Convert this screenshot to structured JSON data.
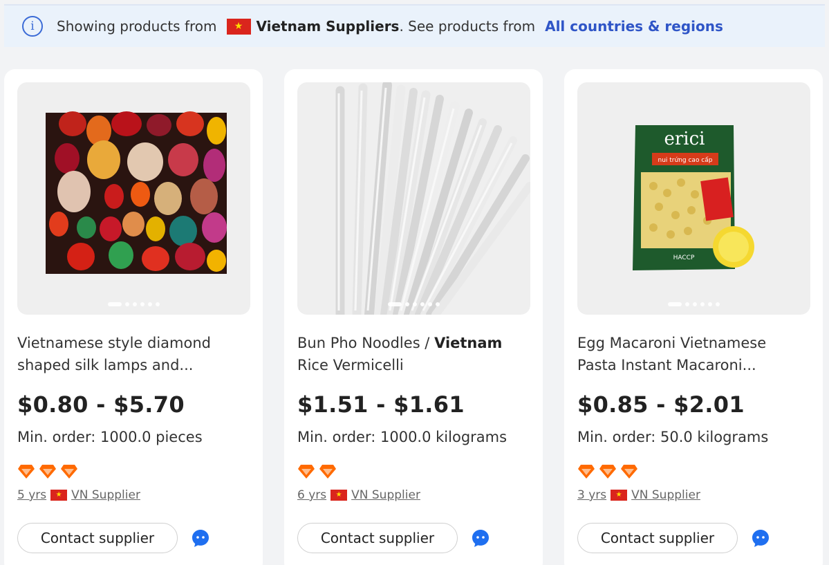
{
  "banner": {
    "prefix": "Showing products from",
    "country": "Vietnam Suppliers",
    "middle": ". See products from",
    "link": "All countries & regions"
  },
  "products": [
    {
      "title": "Vietnamese style diamond shaped silk lamps and...",
      "price": "$0.80 - $5.70",
      "moq": "Min. order: 1000.0 pieces",
      "years": "5 yrs",
      "supplier": "VN Supplier",
      "contact_label": "Contact supplier",
      "image": "silk-lanterns-image"
    },
    {
      "title_pre": "Bun Pho Noodles / ",
      "title_bold": "Vietnam",
      "title_post": " Rice Vermicelli",
      "price": "$1.51 - $1.61",
      "moq": "Min. order: 1000.0 kilograms",
      "years": "6 yrs",
      "supplier": "VN Supplier",
      "contact_label": "Contact supplier",
      "image": "rice-vermicelli-image"
    },
    {
      "title": "Egg Macaroni Vietnamese Pasta Instant Macaroni...",
      "price": "$0.85 - $2.01",
      "moq": "Min. order: 50.0 kilograms",
      "years": "3 yrs",
      "supplier": "VN Supplier",
      "contact_label": "Contact supplier",
      "image": "macaroni-bag-image",
      "bag_brand": "erici",
      "bag_tagline": "nui trứng cao cấp",
      "bag_badge": "HACCP"
    }
  ],
  "colors": {
    "accent": "#2f55c7",
    "diamond": "#ff6a00",
    "chat": "#1f6ff0",
    "flag_red": "#da251d",
    "flag_star": "#ffdd00"
  }
}
